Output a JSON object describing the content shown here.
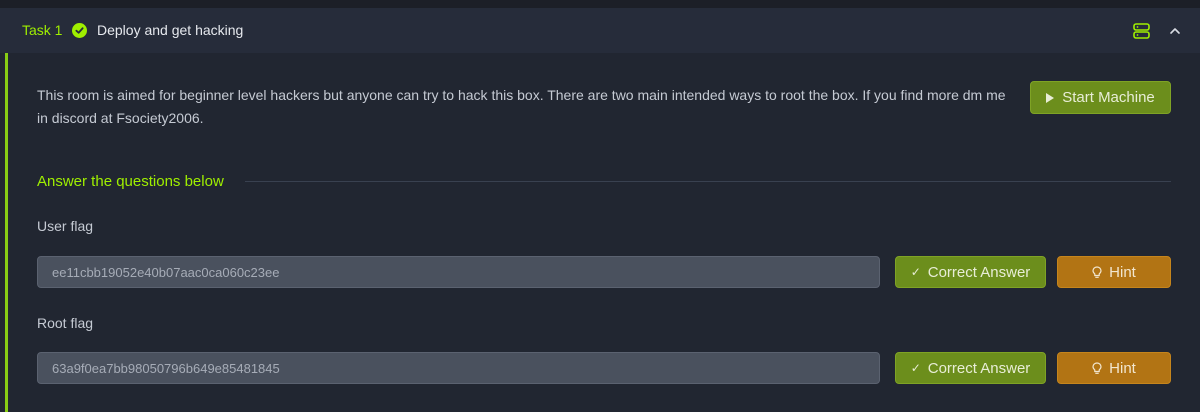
{
  "task": {
    "number_label": "Task 1",
    "title": "Deploy and get hacking"
  },
  "description": "This room is aimed for beginner level hackers but anyone can try to hack this box. There are two main intended ways to root the box. If you find more dm me in discord at Fsociety2006.",
  "start_machine_label": "Start Machine",
  "section_title": "Answer the questions below",
  "questions": [
    {
      "label": "User flag",
      "answer": "ee11cbb19052e40b07aac0ca060c23ee",
      "correct_label": "Correct Answer",
      "hint_label": "Hint"
    },
    {
      "label": "Root flag",
      "answer": "63a9f0ea7bb98050796b649e85481845",
      "correct_label": "Correct Answer",
      "hint_label": "Hint"
    }
  ],
  "colors": {
    "accent": "#9fef00",
    "green_button": "#6c8e1c",
    "amber_button": "#b27414",
    "background": "#212631"
  },
  "icons": {
    "task_status": "check-circle-icon",
    "server": "server-icon",
    "collapse": "chevron-up-icon",
    "start": "play-icon",
    "correct": "check-icon",
    "hint": "lightbulb-icon"
  }
}
